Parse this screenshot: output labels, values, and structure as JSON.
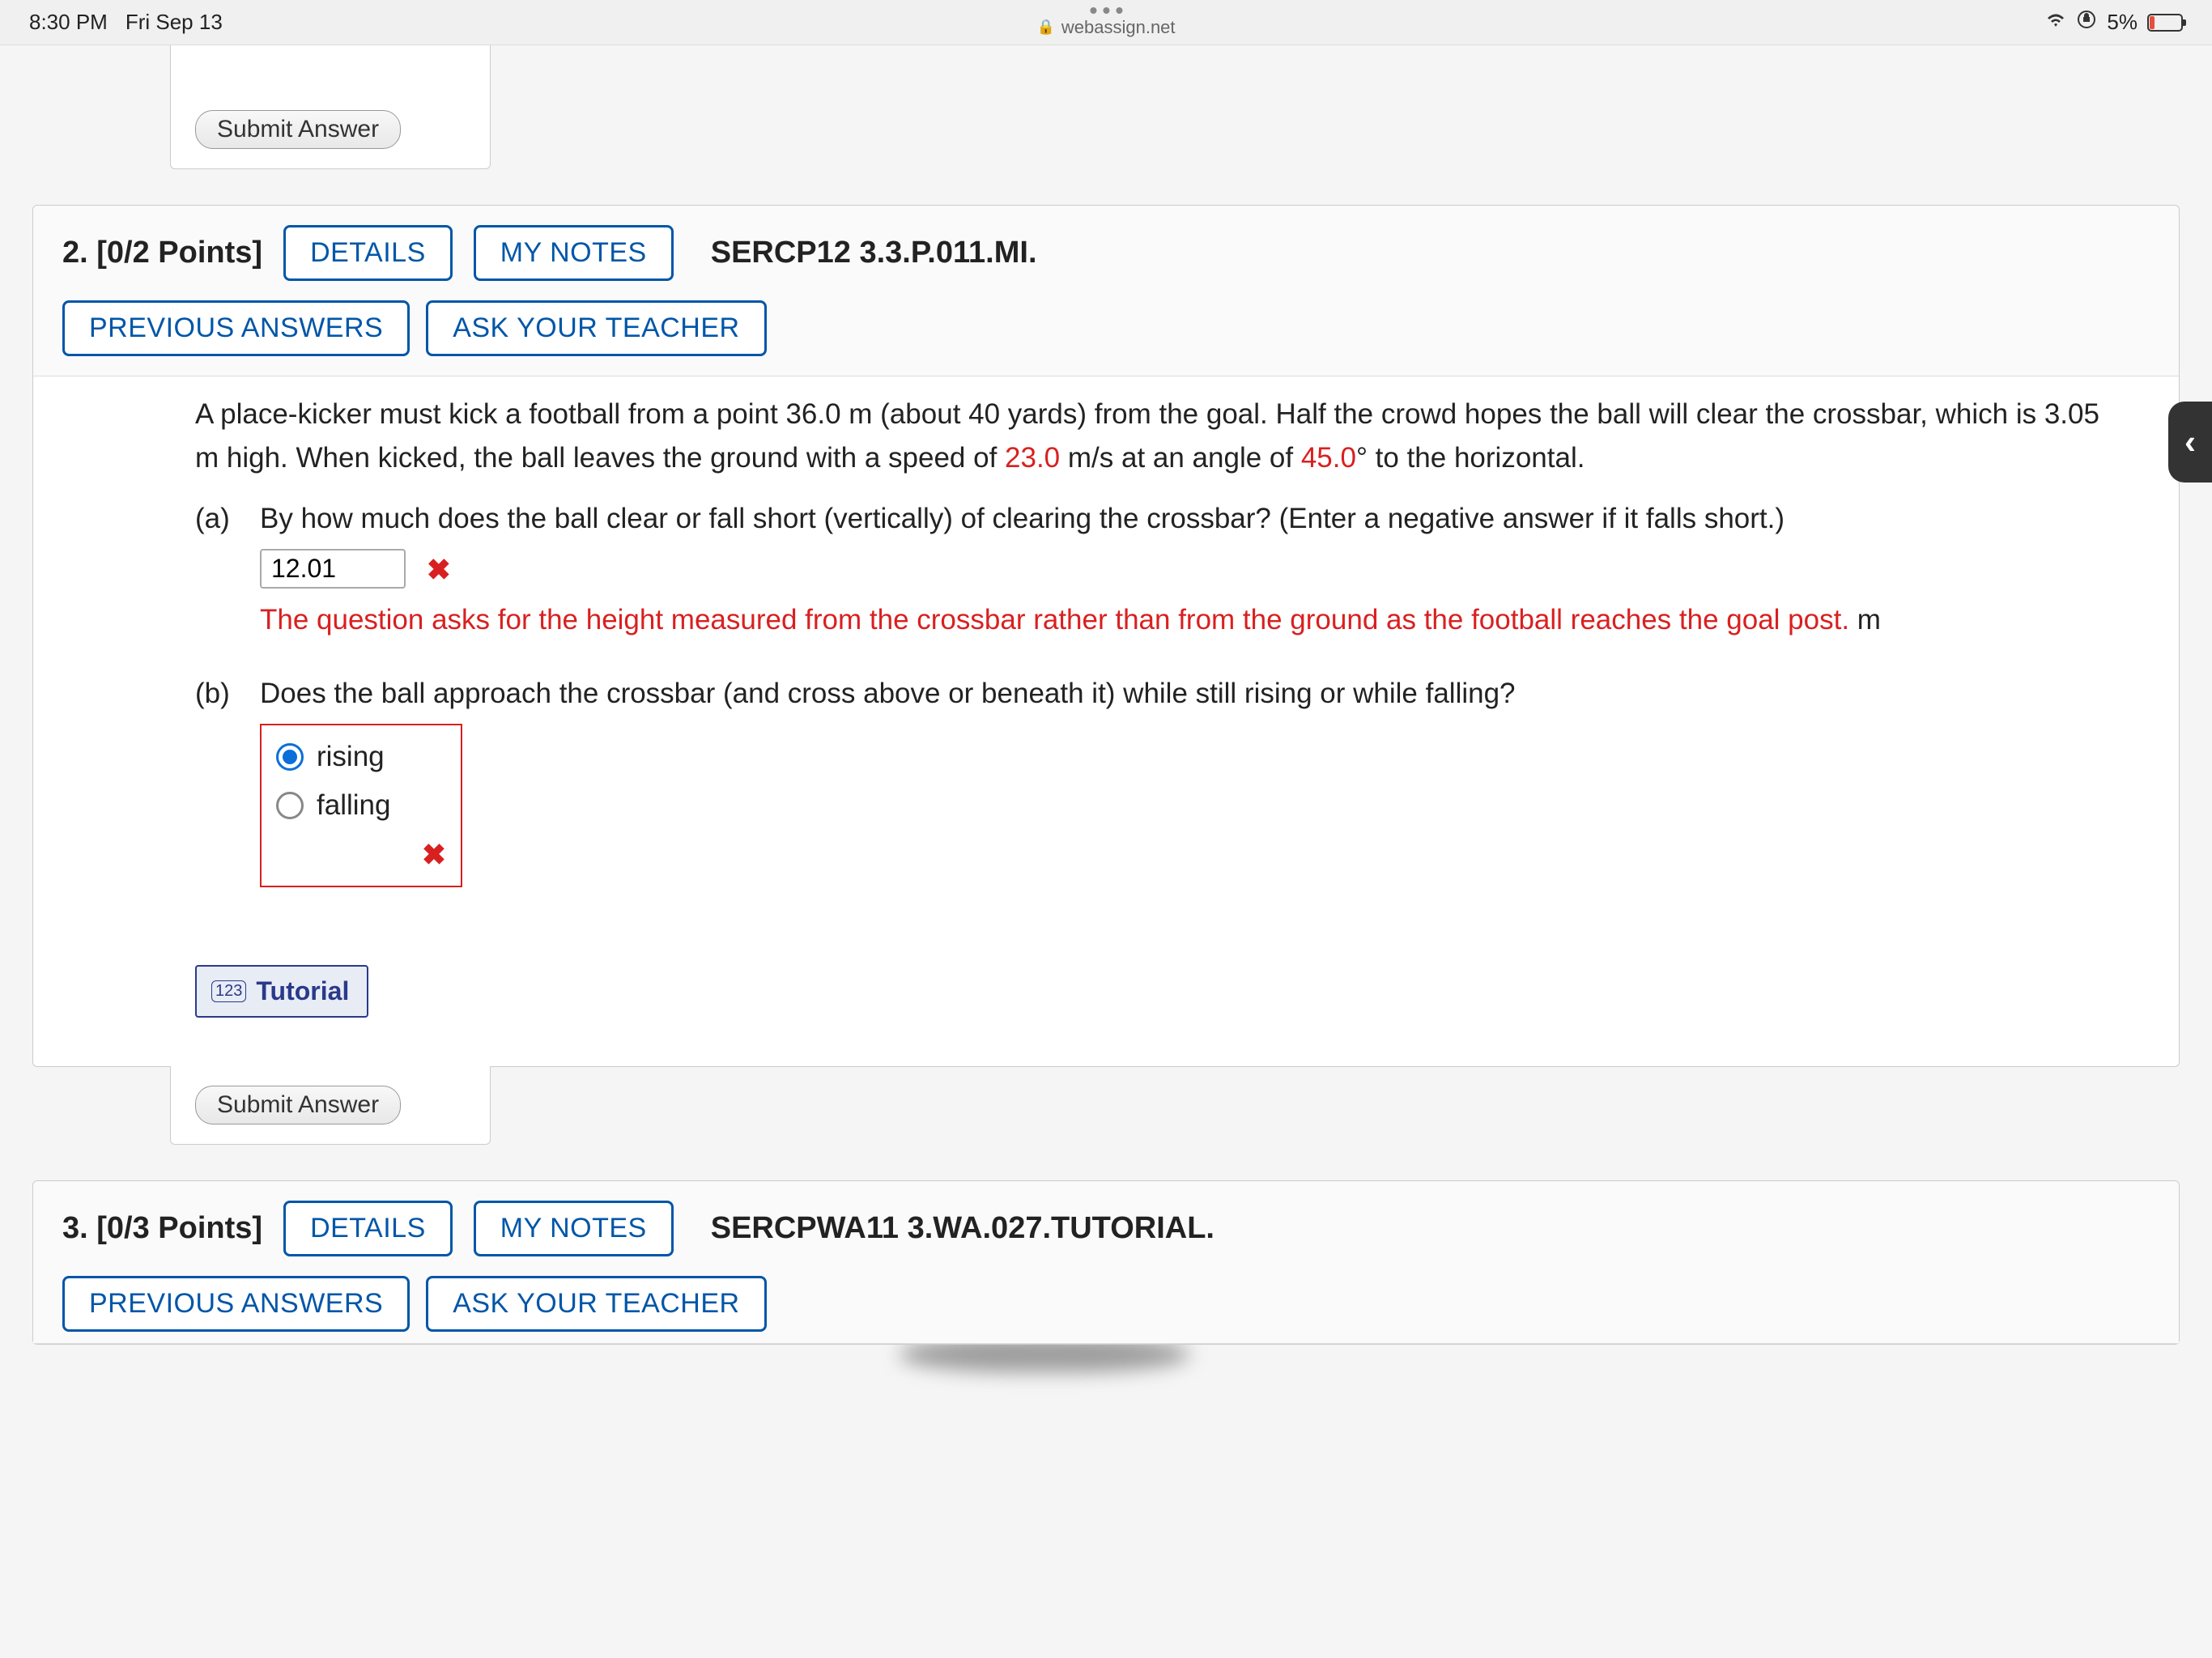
{
  "status": {
    "time": "8:30 PM",
    "date": "Fri Sep 13",
    "url": "webassign.net",
    "battery_pct": "5%"
  },
  "submit_label": "Submit Answer",
  "q2": {
    "number": "2.",
    "points": "[0/2 Points]",
    "details_btn": "DETAILS",
    "notes_btn": "MY NOTES",
    "code": "SERCP12 3.3.P.011.MI.",
    "prev_btn": "PREVIOUS ANSWERS",
    "ask_btn": "ASK YOUR TEACHER",
    "intro_pre": "A place-kicker must kick a football from a point 36.0 m (about 40 yards) from the goal. Half the crowd hopes the ball will clear the crossbar, which is 3.05 m high. When kicked, the ball leaves the ground with a speed of ",
    "intro_speed": "23.0",
    "intro_mid": " m/s at an angle of ",
    "intro_angle": "45.0",
    "intro_post": "° to the horizontal.",
    "part_a": {
      "label": "(a)",
      "text": "By how much does the ball clear or fall short (vertically) of clearing the crossbar? (Enter a negative answer if it falls short.)",
      "value": "12.01",
      "feedback": "The question asks for the height measured from the crossbar rather than from the ground as the football reaches the goal post.",
      "unit": "m"
    },
    "part_b": {
      "label": "(b)",
      "text": "Does the ball approach the crossbar (and cross above or beneath it) while still rising or while falling?",
      "opt1": "rising",
      "opt2": "falling",
      "selected": "rising"
    },
    "tutorial_btn": "Tutorial"
  },
  "q3": {
    "number": "3.",
    "points": "[0/3 Points]",
    "details_btn": "DETAILS",
    "notes_btn": "MY NOTES",
    "code": "SERCPWA11 3.WA.027.TUTORIAL.",
    "prev_btn": "PREVIOUS ANSWERS",
    "ask_btn": "ASK YOUR TEACHER"
  },
  "icons": {
    "x": "✖",
    "chevron": "‹"
  }
}
